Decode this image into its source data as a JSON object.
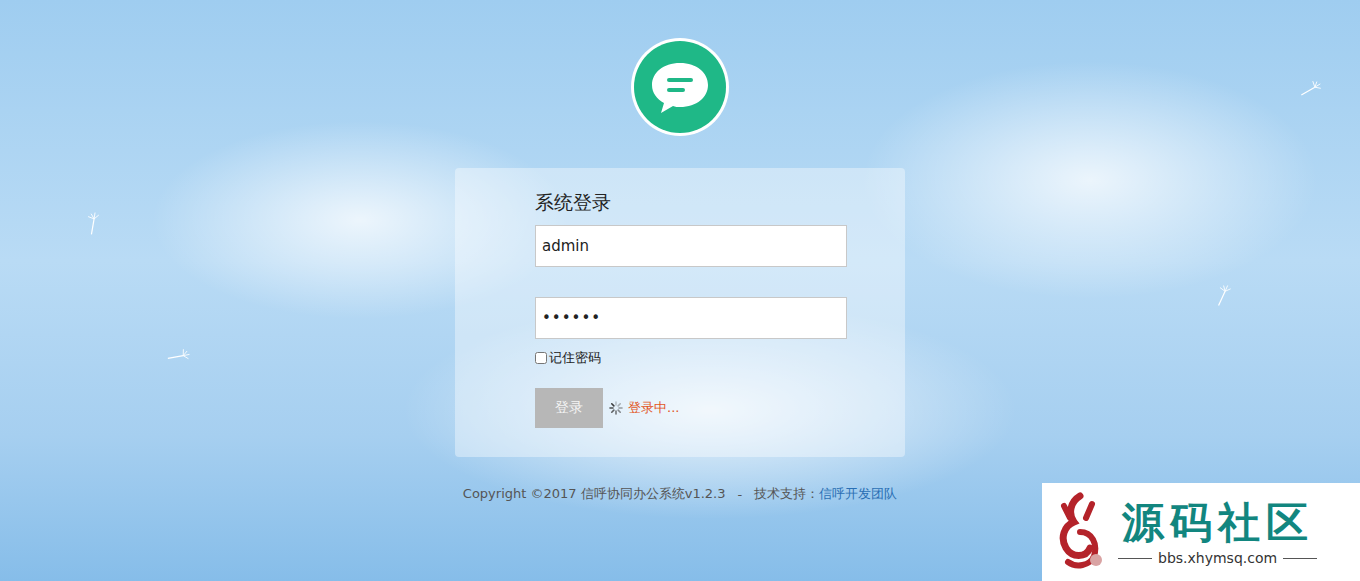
{
  "login": {
    "title": "系统登录",
    "username": "admin",
    "password": "••••••",
    "remember": {
      "label": "记住密码",
      "checked": false
    },
    "button": {
      "label": "登录",
      "disabled": true
    },
    "status": "登录中..."
  },
  "footer": {
    "copyright": "Copyright ©2017 信呼协同办公系统v1.2.3",
    "separator": "-",
    "support_label": "技术支持：",
    "support_link": "信呼开发团队"
  },
  "watermark": {
    "name": "源码社区",
    "url": "bbs.xhymsq.com"
  }
}
